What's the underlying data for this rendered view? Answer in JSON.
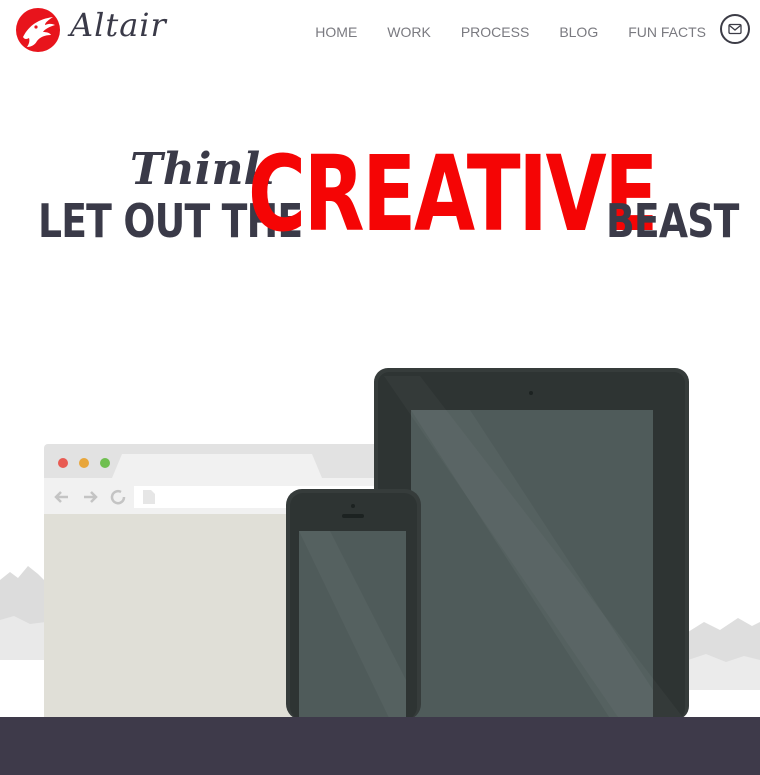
{
  "brand": {
    "name": "Altair",
    "logo_icon": "eagle-icon",
    "accent_color": "#e8141c"
  },
  "nav": {
    "items": [
      {
        "label": "HOME"
      },
      {
        "label": "WORK"
      },
      {
        "label": "PROCESS"
      },
      {
        "label": "BLOG"
      },
      {
        "label": "FUN FACTS"
      }
    ],
    "contact_icon": "mail-icon"
  },
  "hero": {
    "script_word": "Think",
    "line_start": "LET OUT THE",
    "highlight": "CREATIVE",
    "line_end": "BEAST",
    "highlight_color": "#f50505",
    "text_color": "#3a3a48"
  },
  "illustration": {
    "devices": [
      "browser-window",
      "smartphone",
      "tablet"
    ],
    "browser_dots": [
      "#e85b53",
      "#e8a63b",
      "#6fbf50"
    ]
  },
  "footer": {
    "color": "#3e3a4a"
  }
}
